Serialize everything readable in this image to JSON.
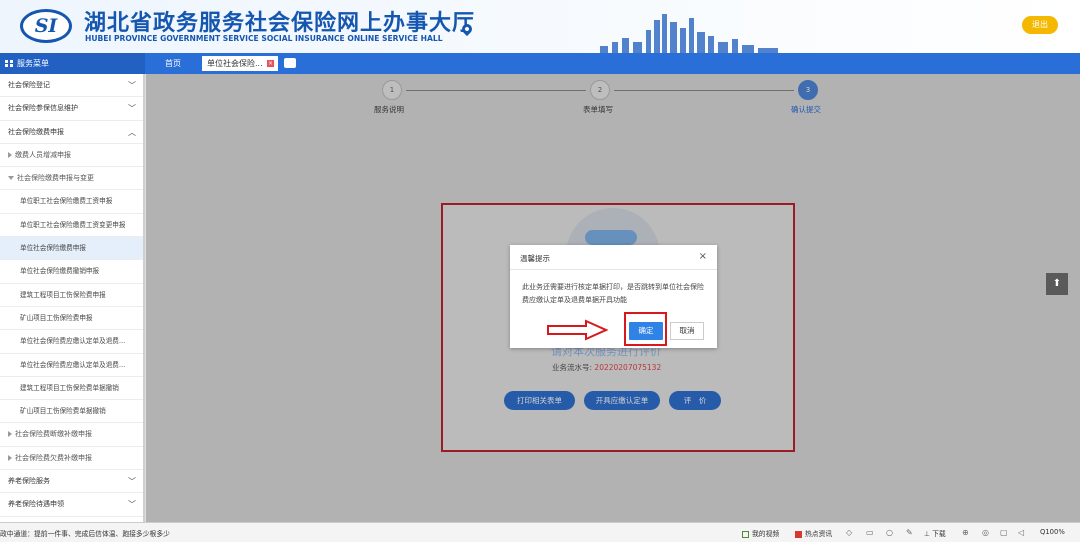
{
  "header": {
    "logo_text": "SI",
    "title": "湖北省政务服务社会保险网上办事大厅",
    "subtitle": "HUBEI PROVINCE GOVERNMENT SERVICE SOCIAL INSURANCE ONLINE SERVICE HALL",
    "exit_label": "退出"
  },
  "nav": {
    "menu_title": "服务菜单",
    "home_tab": "首页",
    "active_tab": "单位社会保险..."
  },
  "sidebar": {
    "items": [
      {
        "label": "社会保险登记",
        "type": "group",
        "expanded": false
      },
      {
        "label": "社会保险参保信息维护",
        "type": "group",
        "expanded": false
      },
      {
        "label": "社会保险缴费申报",
        "type": "group",
        "expanded": true
      },
      {
        "label": "缴费人员增减申报",
        "type": "sub",
        "expanded": false
      },
      {
        "label": "社会保险缴费申报与变更",
        "type": "sub",
        "expanded": true
      },
      {
        "label": "单位职工社会保险缴费工资申报",
        "type": "leaf"
      },
      {
        "label": "单位职工社会保险缴费工资变更申报",
        "type": "leaf"
      },
      {
        "label": "单位社会保险缴费申报",
        "type": "leaf",
        "active": true
      },
      {
        "label": "单位社会保险缴费撤销申报",
        "type": "leaf"
      },
      {
        "label": "建筑工程项目工伤保险费申报",
        "type": "leaf"
      },
      {
        "label": "矿山项目工伤保险费申报",
        "type": "leaf"
      },
      {
        "label": "单位社会保险费应缴认定单及退费...",
        "type": "leaf"
      },
      {
        "label": "单位社会保险费应缴认定单及退费...",
        "type": "leaf"
      },
      {
        "label": "建筑工程项目工伤保险费单据撤销",
        "type": "leaf"
      },
      {
        "label": "矿山项目工伤保险费单据撤销",
        "type": "leaf"
      },
      {
        "label": "社会保险费断缴补缴申报",
        "type": "sub",
        "expanded": false
      },
      {
        "label": "社会保险费欠费补缴申报",
        "type": "sub",
        "expanded": false
      },
      {
        "label": "养老保险服务",
        "type": "group",
        "expanded": false
      },
      {
        "label": "养老保险待遇申领",
        "type": "group",
        "expanded": false
      }
    ]
  },
  "steps": [
    {
      "number": "1",
      "label": "服务说明"
    },
    {
      "number": "2",
      "label": "表单填写"
    },
    {
      "number": "3",
      "label": "确认提交"
    }
  ],
  "result_card": {
    "evaluation_prompt": "请对本次服务进行评价",
    "serial_label": "业务流水号:",
    "serial_number": "20220207075132",
    "buttons": [
      "打印相关表单",
      "开具应缴认定单",
      "评　价"
    ]
  },
  "dialog": {
    "title": "温馨提示",
    "close_symbol": "×",
    "message": "此业务还需要进行核定单据打印，是否跳转到单位社会保险费应缴认定单及退费单据开具功能",
    "confirm_label": "确定",
    "cancel_label": "取消"
  },
  "float_button_symbol": "⬆",
  "statusbar": {
    "left_text": "政中通道：提前一件事、完成后信体温、跑接多少根多少",
    "items": [
      "我的视频",
      "热点资讯",
      "下载",
      "100%"
    ]
  },
  "colors": {
    "brand_blue": "#1557b0",
    "nav_blue": "#2a6ed7",
    "exit_yellow": "#f5b800",
    "annotation_red": "#d6191f",
    "serial_red": "#e0464c"
  }
}
